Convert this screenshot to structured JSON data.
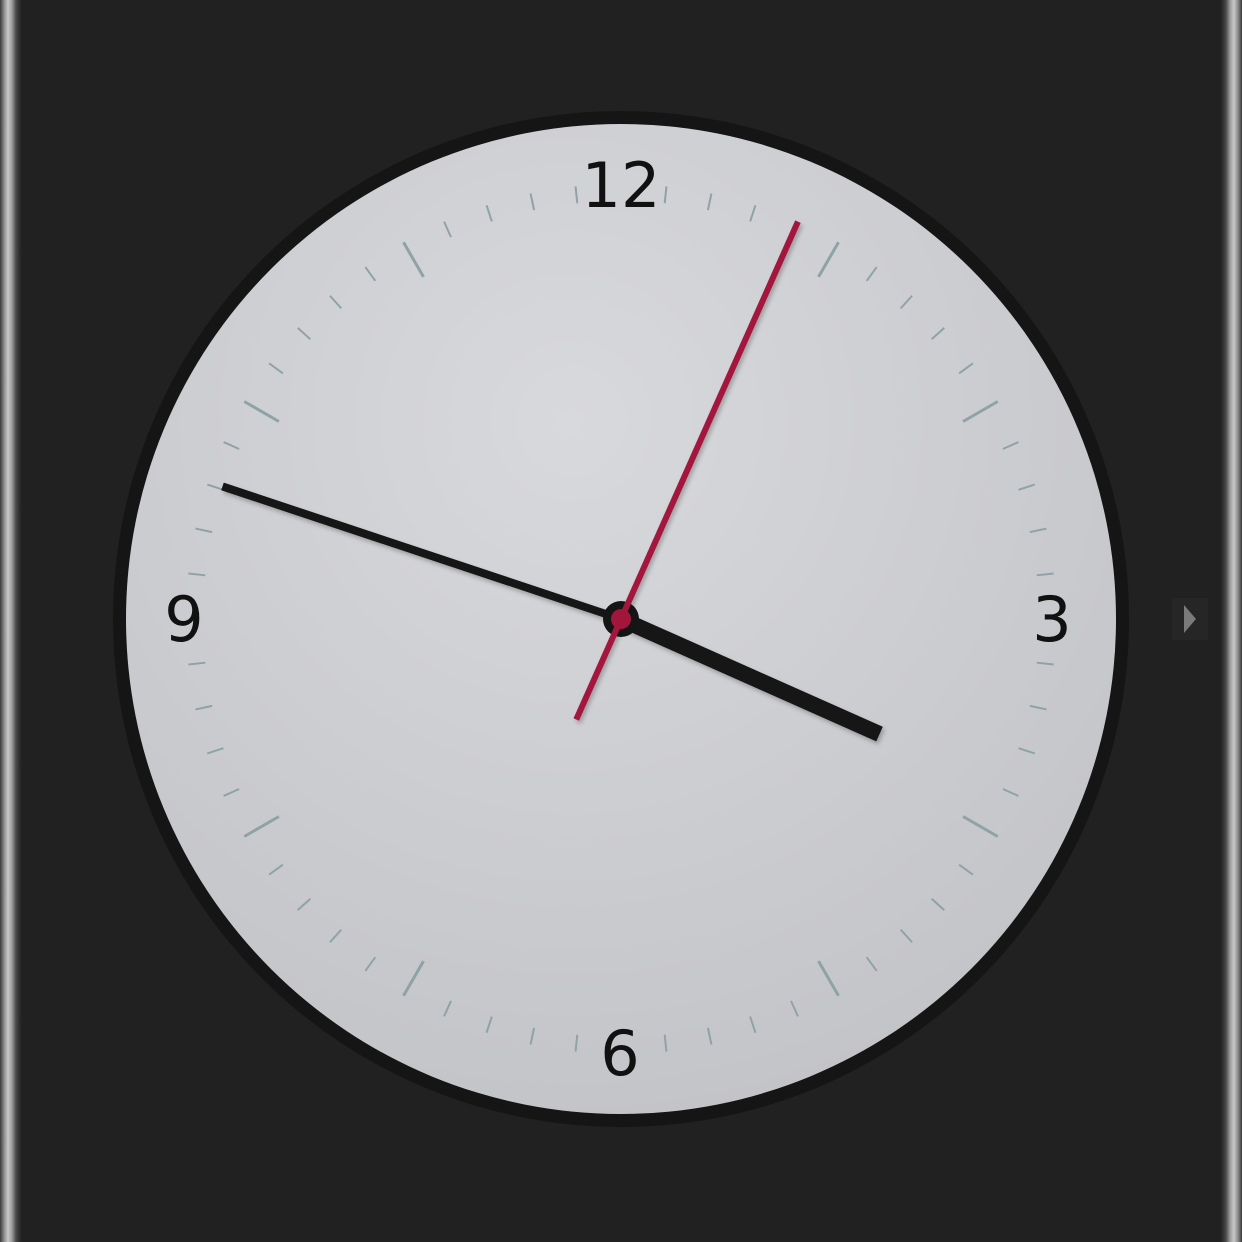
{
  "clock": {
    "numerals": {
      "n12": "12",
      "n3": "3",
      "n6": "6",
      "n9": "9"
    },
    "time": {
      "hours": 3,
      "minutes": 48,
      "seconds": 4
    },
    "colors": {
      "background": "#212121",
      "face": "#cfd0d3",
      "rim": "#151515",
      "hands": "#151515",
      "second_hand": "#a3163c",
      "ticks": "#8fa3a6"
    }
  },
  "nav": {
    "next_icon": "triangle-right-icon"
  }
}
